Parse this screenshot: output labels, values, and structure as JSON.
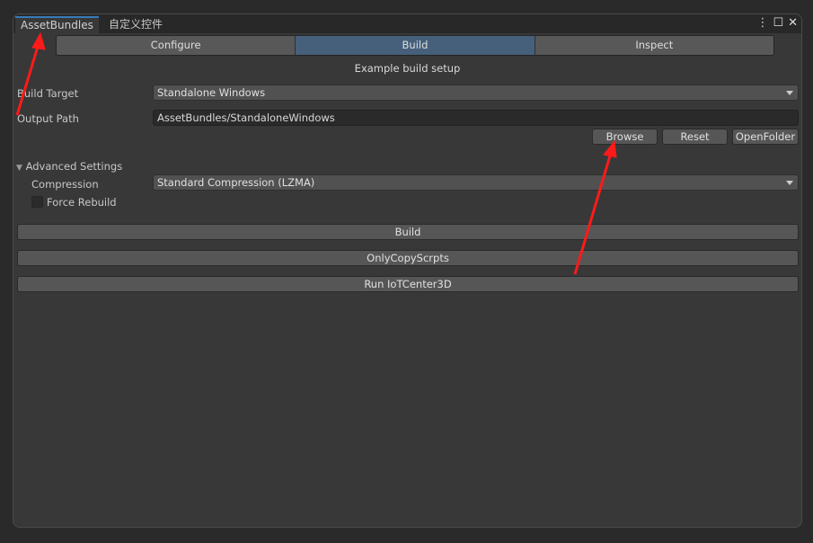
{
  "tabs": [
    "AssetBundles",
    "自定义控件"
  ],
  "window_icons": [
    "more-icon",
    "maximize-icon",
    "close-icon"
  ],
  "segments": [
    {
      "label": "Configure"
    },
    {
      "label": "Build",
      "selected": true
    },
    {
      "label": "Inspect"
    }
  ],
  "subtitle": "Example build setup",
  "build_target": {
    "label": "Build Target",
    "value": "Standalone Windows"
  },
  "output_path": {
    "label": "Output Path",
    "value": "AssetBundles/StandaloneWindows"
  },
  "path_buttons": [
    "Browse",
    "Reset",
    "OpenFolder"
  ],
  "advanced": {
    "label": "Advanced Settings",
    "compression_label": "Compression",
    "compression_value": "Standard Compression (LZMA)",
    "force_rebuild_label": "Force Rebuild",
    "force_rebuild": false
  },
  "actions": [
    "Build",
    "OnlyCopyScrpts",
    "Run IoTCenter3D"
  ],
  "annotation_color": "#ff1a1a"
}
